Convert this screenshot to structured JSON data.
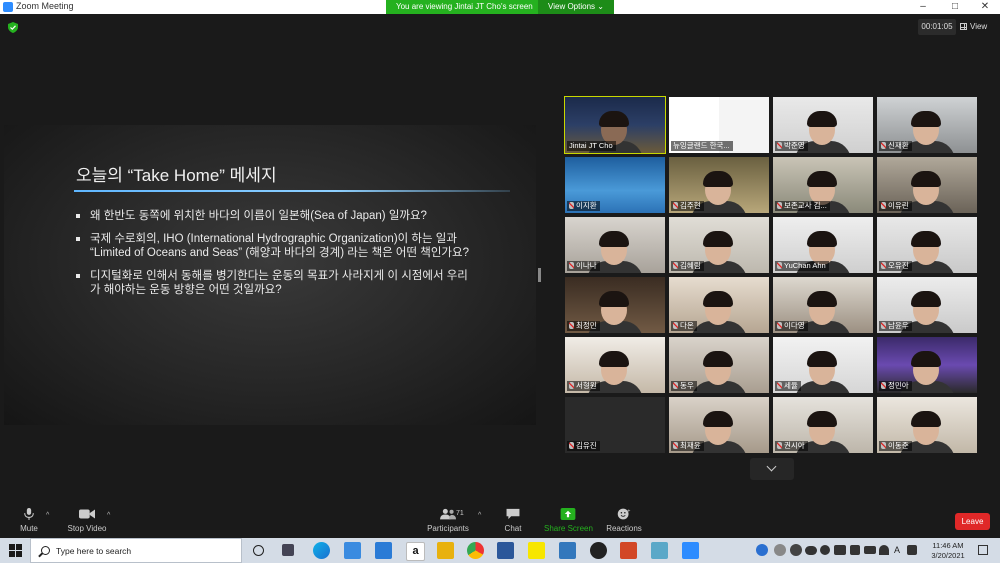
{
  "window": {
    "title": "Zoom Meeting",
    "controls": [
      "–",
      "□",
      "✕"
    ]
  },
  "share_banner": {
    "text": "You are viewing Jintai JT Cho's screen",
    "view_options": "View Options ⌄"
  },
  "topbar": {
    "timer": "00:01:05",
    "view_label": "View"
  },
  "slide": {
    "title": "오늘의 “Take Home” 메세지",
    "bullets": [
      "왜 한반도 동쪽에 위치한 바다의 이름이 일본해(Sea of Japan) 일까요?",
      "국제 수로회의, IHO (International Hydrographic Organization)이 하는 일과 “Limited of Oceans and Seas” (해양과 바다의 경계) 라는 책은 어떤 책인가요?",
      "디지털화로 인해서 동해를 병기한다는 운동의 목표가 사라지게 이 시점에서 우리가 해야하는 운동 방향은 어떤 것일까요?"
    ]
  },
  "participants": [
    {
      "name": "Jintai JT Cho",
      "muted": false
    },
    {
      "name": "뉴잉글랜드 한국...",
      "muted": false
    },
    {
      "name": "박준영",
      "muted": true
    },
    {
      "name": "신재환",
      "muted": true
    },
    {
      "name": "이지환",
      "muted": true
    },
    {
      "name": "김주현",
      "muted": true
    },
    {
      "name": "보존교사 김...",
      "muted": true
    },
    {
      "name": "이유린",
      "muted": true
    },
    {
      "name": "이나나",
      "muted": true
    },
    {
      "name": "김혜림",
      "muted": true
    },
    {
      "name": "YuChan Ahn",
      "muted": true
    },
    {
      "name": "오유진",
      "muted": true
    },
    {
      "name": "최정민",
      "muted": true
    },
    {
      "name": "다온",
      "muted": true
    },
    {
      "name": "이다영",
      "muted": true
    },
    {
      "name": "남윤우",
      "muted": true
    },
    {
      "name": "서형원",
      "muted": true
    },
    {
      "name": "동우",
      "muted": true
    },
    {
      "name": "세율",
      "muted": true
    },
    {
      "name": "정민아",
      "muted": true
    },
    {
      "name": "김유진",
      "muted": true
    },
    {
      "name": "최재윤",
      "muted": true
    },
    {
      "name": "권시아",
      "muted": true
    },
    {
      "name": "이동준",
      "muted": true
    }
  ],
  "toolbar": {
    "mute": "Mute",
    "stop_video": "Stop Video",
    "participants": "Participants",
    "participants_count": "71",
    "chat": "Chat",
    "share_screen": "Share Screen",
    "reactions": "Reactions",
    "leave": "Leave"
  },
  "taskbar": {
    "search_placeholder": "Type here to search",
    "time": "11:46 AM",
    "date": "3/20/2021",
    "lang": "A"
  },
  "colors": {
    "share_green": "#25b11f",
    "leave_red": "#e02828",
    "active_speaker": "#c8d800"
  }
}
